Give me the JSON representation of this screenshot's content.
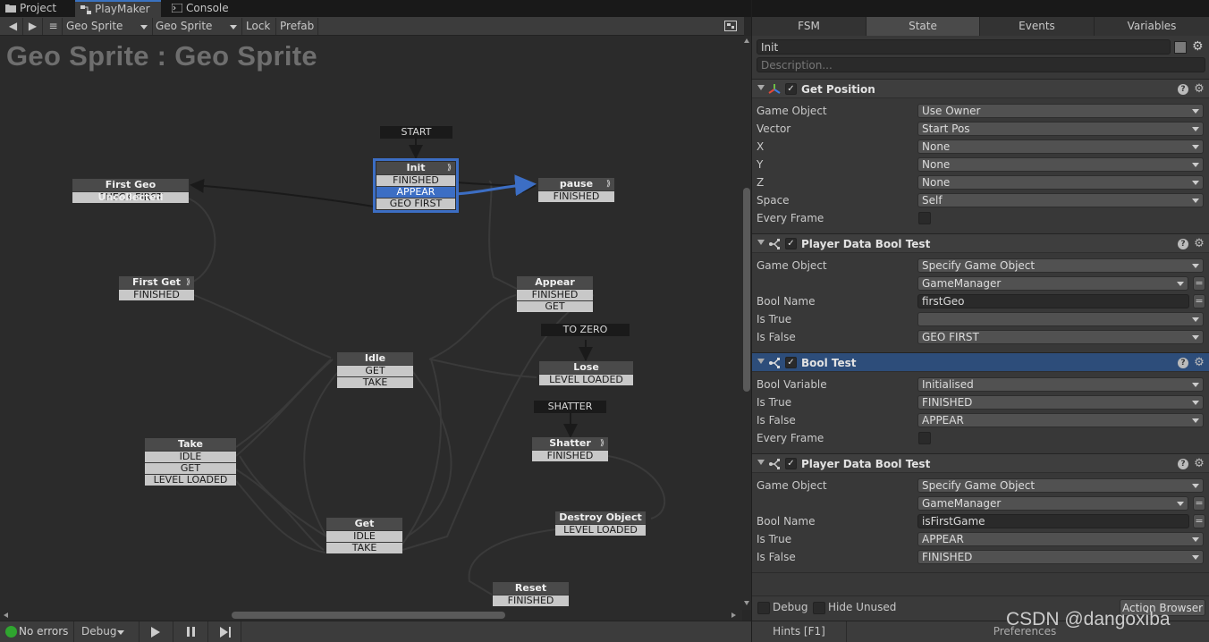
{
  "window_tabs": [
    {
      "label": "Project",
      "icon": "folder-icon"
    },
    {
      "label": "PlayMaker",
      "icon": "playmaker-icon"
    },
    {
      "label": "Console",
      "icon": "console-icon"
    }
  ],
  "toolbar": {
    "back": "◀",
    "forward": "▶",
    "menu": "≡",
    "object_select": "Geo Sprite",
    "fsm_select": "Geo Sprite",
    "lock_label": "Lock",
    "prefab_label": "Prefab"
  },
  "graph": {
    "title": "Geo Sprite : Geo Sprite",
    "global_events": {
      "start": "START",
      "to_zero": "TO ZERO",
      "shatter": "SHATTER"
    },
    "states": {
      "init": {
        "name": "Init",
        "events": [
          "FINISHED",
          "APPEAR",
          "GEO FIRST"
        ]
      },
      "pause": {
        "name": "pause",
        "events": [
          "FINISHED"
        ]
      },
      "first_geo": {
        "name": "First Geo Uncollected",
        "events": [
          "CHECK FIRST"
        ]
      },
      "first_get": {
        "name": "First Get",
        "events": [
          "FINISHED"
        ]
      },
      "appear": {
        "name": "Appear",
        "events": [
          "FINISHED",
          "GET"
        ]
      },
      "lose": {
        "name": "Lose",
        "events": [
          "LEVEL LOADED"
        ]
      },
      "idle": {
        "name": "Idle",
        "events": [
          "GET",
          "TAKE"
        ]
      },
      "shatter": {
        "name": "Shatter",
        "events": [
          "FINISHED"
        ]
      },
      "take": {
        "name": "Take",
        "events": [
          "IDLE",
          "GET",
          "LEVEL LOADED"
        ]
      },
      "get": {
        "name": "Get",
        "events": [
          "IDLE",
          "TAKE"
        ]
      },
      "destroy": {
        "name": "Destroy Object",
        "events": [
          "LEVEL LOADED"
        ]
      },
      "reset": {
        "name": "Reset",
        "events": [
          "FINISHED"
        ]
      }
    },
    "transition_glyph": "⟫"
  },
  "status": {
    "errors": "No errors",
    "debug": "Debug",
    "hints": "Hints [F1]",
    "preferences": "Preferences"
  },
  "right_panel": {
    "tabs": [
      "FSM",
      "State",
      "Events",
      "Variables"
    ],
    "state_name": "Init",
    "description_placeholder": "Description...",
    "actions": [
      {
        "title": "Get Position",
        "icon": "axis-icon",
        "rows": [
          {
            "label": "Game Object",
            "type": "dropdown",
            "value": "Use Owner"
          },
          {
            "label": "Vector",
            "type": "dropdown",
            "value": "Start Pos"
          },
          {
            "label": "X",
            "type": "dropdown",
            "value": "None"
          },
          {
            "label": "Y",
            "type": "dropdown",
            "value": "None"
          },
          {
            "label": "Z",
            "type": "dropdown",
            "value": "None"
          },
          {
            "label": "Space",
            "type": "dropdown",
            "value": "Self"
          },
          {
            "label": "Every Frame",
            "type": "checkbox",
            "value": ""
          }
        ]
      },
      {
        "title": "Player Data Bool Test",
        "icon": "branch-icon",
        "rows": [
          {
            "label": "Game Object",
            "type": "dropdown",
            "value": "Specify Game Object"
          },
          {
            "label": "",
            "type": "dropdown-eq",
            "value": "GameManager"
          },
          {
            "label": "Bool Name",
            "type": "text-eq",
            "value": "firstGeo"
          },
          {
            "label": "Is True",
            "type": "dropdown",
            "value": ""
          },
          {
            "label": "Is False",
            "type": "dropdown",
            "value": "GEO FIRST"
          }
        ]
      },
      {
        "title": "Bool Test",
        "icon": "branch-icon",
        "rows": [
          {
            "label": "Bool Variable",
            "type": "dropdown",
            "value": "Initialised"
          },
          {
            "label": "Is True",
            "type": "dropdown",
            "value": "FINISHED"
          },
          {
            "label": "Is False",
            "type": "dropdown",
            "value": "APPEAR"
          },
          {
            "label": "Every Frame",
            "type": "checkbox",
            "value": ""
          }
        ]
      },
      {
        "title": "Player Data Bool Test",
        "icon": "branch-icon",
        "rows": [
          {
            "label": "Game Object",
            "type": "dropdown",
            "value": "Specify Game Object"
          },
          {
            "label": "",
            "type": "dropdown-eq",
            "value": "GameManager"
          },
          {
            "label": "Bool Name",
            "type": "text-eq",
            "value": "isFirstGame"
          },
          {
            "label": "Is True",
            "type": "dropdown",
            "value": "APPEAR"
          },
          {
            "label": "Is False",
            "type": "dropdown",
            "value": "FINISHED"
          }
        ]
      }
    ],
    "footer": {
      "debug_label": "Debug",
      "hide_unused_label": "Hide Unused",
      "action_browser": "Action Browser"
    },
    "watermark": "CSDN @dangoxiba",
    "colors": {
      "accent": "#3c6ec4",
      "selected_header": "#2d4d7a"
    }
  }
}
